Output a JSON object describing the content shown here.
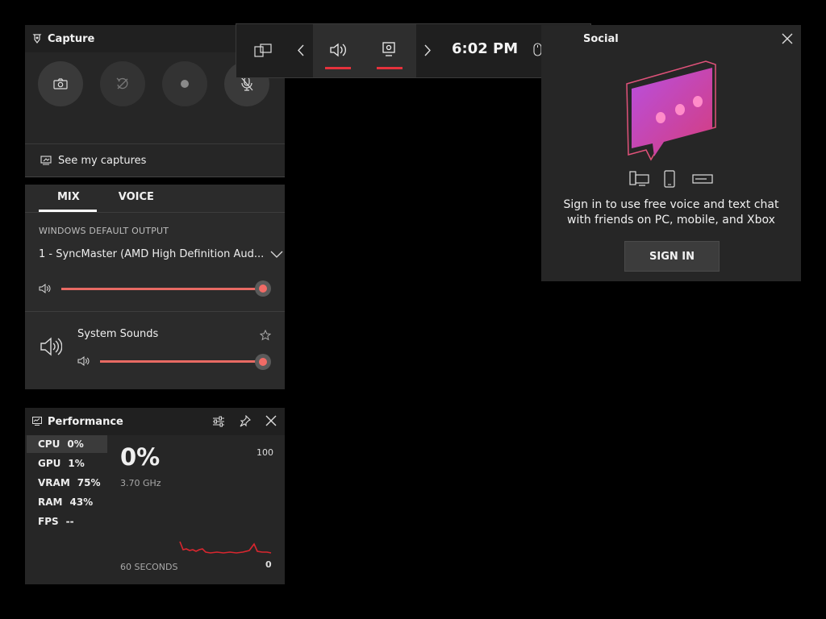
{
  "capture": {
    "title": "Capture",
    "see_captures": "See my captures",
    "buttons": [
      {
        "name": "screenshot",
        "icon": "camera-icon"
      },
      {
        "name": "record-last",
        "icon": "record-last-icon"
      },
      {
        "name": "start-recording",
        "icon": "record-dot-icon"
      },
      {
        "name": "mic",
        "icon": "mic-off-icon"
      }
    ]
  },
  "audio": {
    "tabs": [
      "MIX",
      "VOICE"
    ],
    "output_label": "WINDOWS DEFAULT OUTPUT",
    "device": "1 - SyncMaster (AMD High Definition Aud...",
    "master_volume": 100,
    "apps": [
      {
        "name": "System Sounds",
        "volume": 100
      }
    ],
    "accent": "#e86a63"
  },
  "performance": {
    "title": "Performance",
    "metrics": [
      {
        "label": "CPU",
        "value": "0%"
      },
      {
        "label": "GPU",
        "value": "1%"
      },
      {
        "label": "VRAM",
        "value": "75%"
      },
      {
        "label": "RAM",
        "value": "43%"
      },
      {
        "label": "FPS",
        "value": "--"
      }
    ],
    "big_value": "0%",
    "sub_value": "3.70 GHz",
    "scale_max": "100",
    "scale_min": "0",
    "duration": "60 SECONDS",
    "graph_color": "#d9262f"
  },
  "bar": {
    "time": "6:02 PM",
    "notification_color": "#e5323c"
  },
  "social": {
    "title": "Social",
    "message": "Sign in to use free voice and text chat",
    "message2": "with friends on PC, mobile, and Xbox",
    "signin": "SIGN IN"
  }
}
